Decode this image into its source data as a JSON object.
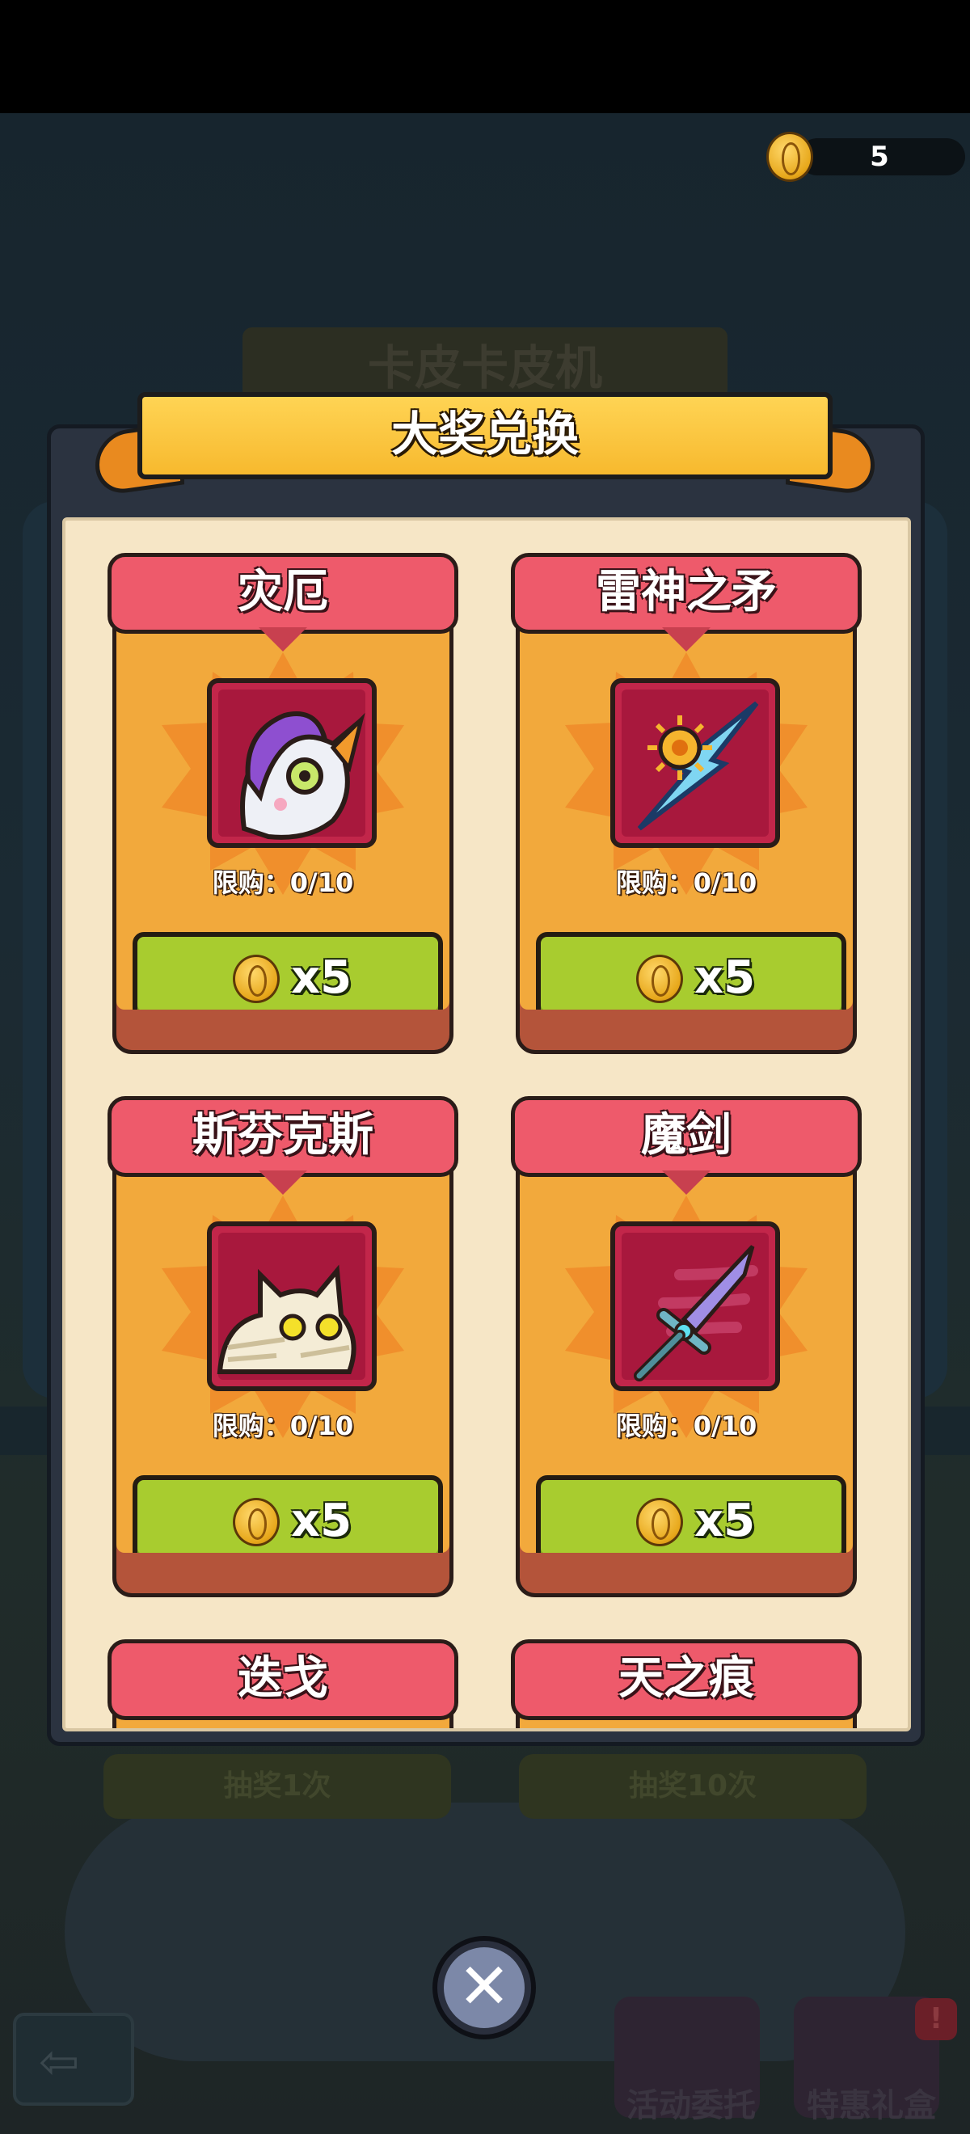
{
  "currency": {
    "icon": "coin-icon",
    "amount": "5"
  },
  "background": {
    "title": "卡皮卡皮机",
    "draw_once_label": "抽奖1次",
    "draw_ten_label": "抽奖10次",
    "nav": {
      "tasks_label": "活动委托",
      "gift_label": "特惠礼盒",
      "gift_badge": "!"
    }
  },
  "dialog": {
    "title": "大奖兑换",
    "items": [
      {
        "name": "灾厄",
        "limit": "限购：0/10",
        "price": "x5",
        "icon": "unicorn-pet-icon"
      },
      {
        "name": "雷神之矛",
        "limit": "限购：0/10",
        "price": "x5",
        "icon": "lightning-spear-icon"
      },
      {
        "name": "斯芬克斯",
        "limit": "限购：0/10",
        "price": "x5",
        "icon": "sphinx-cat-icon"
      },
      {
        "name": "魔剑",
        "limit": "限购：0/10",
        "price": "x5",
        "icon": "magic-sword-icon"
      },
      {
        "name": "迭戈",
        "icon": "unknown"
      },
      {
        "name": "天之痕",
        "icon": "unknown"
      }
    ]
  },
  "colors": {
    "card_header": "#ee5a6b",
    "card_face": "#f2a93c",
    "buy_button": "#a8cc2f",
    "banner": "#f7b92e",
    "panel": "#f6e6c6"
  }
}
